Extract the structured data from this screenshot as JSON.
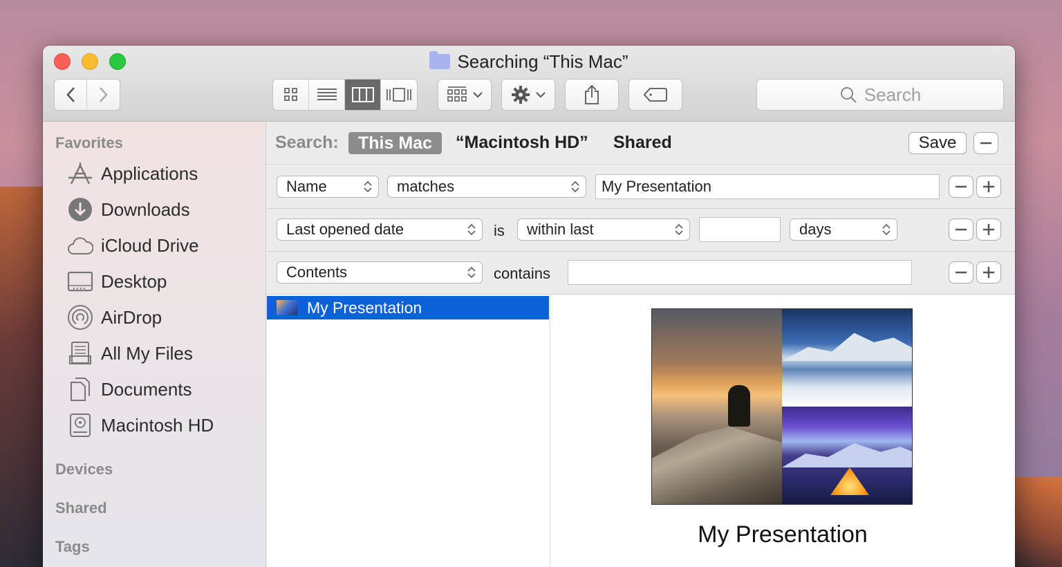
{
  "window": {
    "title": "Searching “This Mac”"
  },
  "toolbar": {
    "search_placeholder": "Search"
  },
  "sidebar": {
    "favorites_header": "Favorites",
    "items": [
      {
        "label": "Applications",
        "icon": "applications-icon"
      },
      {
        "label": "Downloads",
        "icon": "downloads-icon"
      },
      {
        "label": "iCloud Drive",
        "icon": "icloud-icon"
      },
      {
        "label": "Desktop",
        "icon": "desktop-icon"
      },
      {
        "label": "AirDrop",
        "icon": "airdrop-icon"
      },
      {
        "label": "All My Files",
        "icon": "all-files-icon"
      },
      {
        "label": "Documents",
        "icon": "documents-icon"
      },
      {
        "label": "Macintosh HD",
        "icon": "hard-drive-icon"
      }
    ],
    "devices_header": "Devices",
    "shared_header": "Shared",
    "tags_header": "Tags"
  },
  "scope": {
    "label": "Search:",
    "selected": "This Mac",
    "option_hd": "“Macintosh HD”",
    "option_shared": "Shared",
    "save_label": "Save"
  },
  "criteria": [
    {
      "attribute": "Name",
      "operator": "matches",
      "value": "My Presentation"
    },
    {
      "attribute": "Last opened date",
      "connector": "is",
      "operator": "within last",
      "value": "",
      "unit": "days"
    },
    {
      "attribute": "Contents",
      "connector": "contains",
      "value": ""
    }
  ],
  "results": {
    "items": [
      {
        "name": "My Presentation"
      }
    ]
  },
  "preview": {
    "name": "My Presentation"
  },
  "colors": {
    "selection": "#0d61d9",
    "close": "#fc5f57",
    "minimize": "#fdbc2e",
    "maximize": "#28c940"
  }
}
